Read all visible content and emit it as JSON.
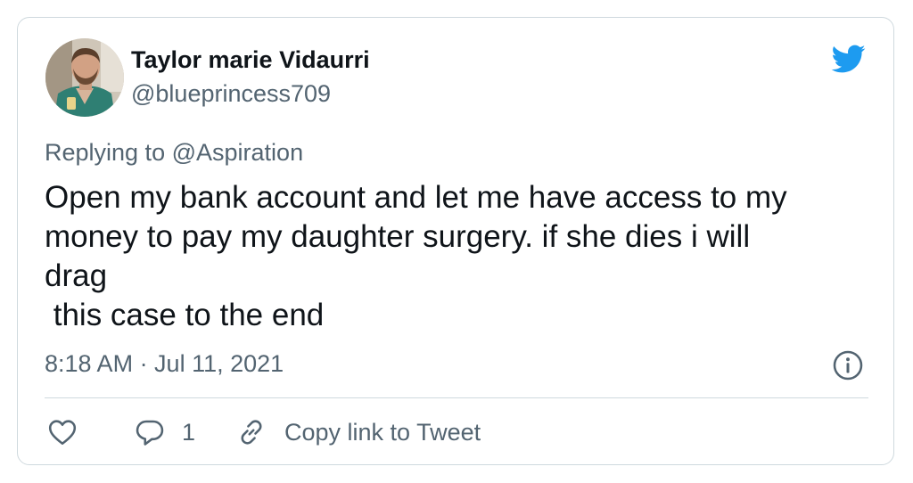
{
  "author": {
    "display_name": "Taylor marie Vidaurri",
    "handle": "@blueprincess709"
  },
  "reply": {
    "prefix": "Replying to",
    "mention": "@Aspiration"
  },
  "tweet": {
    "lines": [
      "Open my bank account and let me have access to my",
      "money to pay my daughter surgery. if she dies i will",
      "drag",
      " this case to the end"
    ],
    "timestamp": "8:18 AM · Jul 11, 2021"
  },
  "actions": {
    "like_icon": "heart-icon",
    "reply_icon": "speech-bubble-icon",
    "reply_count": "1",
    "copy_link_icon": "link-icon",
    "copy_link_label": "Copy link to Tweet"
  },
  "icons": {
    "brand": "twitter-bird-icon",
    "info": "info-icon"
  },
  "colors": {
    "twitter_blue": "#1d9bf0",
    "text_primary": "#0f1419",
    "text_secondary": "#536471",
    "border": "#cfd9de"
  }
}
